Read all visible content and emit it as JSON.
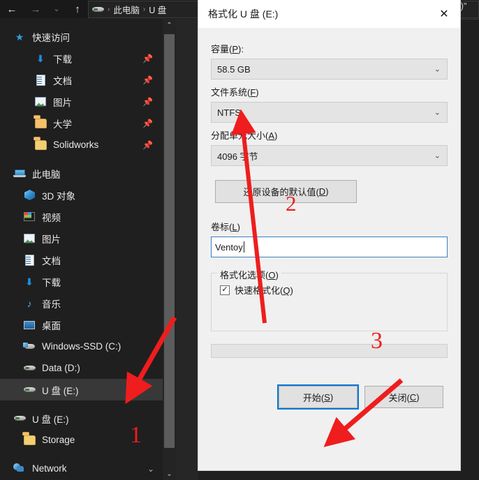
{
  "window": {
    "toolbar": {
      "back_icon": "arrow-left-icon",
      "forward_icon": "arrow-right-icon",
      "history_icon": "chevron-down-icon",
      "up_icon": "arrow-up-icon"
    },
    "breadcrumb": {
      "drive_icon": "drive-icon",
      "sep": "›",
      "items": [
        "此电脑",
        "U 盘"
      ],
      "occluded_tail": "E:)\""
    }
  },
  "sidebar": {
    "groups": [
      {
        "header": {
          "label": "快速访问",
          "icon": "star-icon"
        },
        "items": [
          {
            "label": "下载",
            "icon": "download-icon",
            "pinned": true
          },
          {
            "label": "文档",
            "icon": "document-icon",
            "pinned": true
          },
          {
            "label": "图片",
            "icon": "picture-icon",
            "pinned": true
          },
          {
            "label": "大学",
            "icon": "folder-icon",
            "pinned": true
          },
          {
            "label": "Solidworks",
            "icon": "folder-icon",
            "pinned": true
          }
        ]
      },
      {
        "header": {
          "label": "此电脑",
          "icon": "this-pc-icon"
        },
        "items": [
          {
            "label": "3D 对象",
            "icon": "3d-objects-icon",
            "pinned": false
          },
          {
            "label": "视频",
            "icon": "video-icon",
            "pinned": false
          },
          {
            "label": "图片",
            "icon": "picture-icon",
            "pinned": false
          },
          {
            "label": "文档",
            "icon": "document-icon",
            "pinned": false
          },
          {
            "label": "下载",
            "icon": "download-icon",
            "pinned": false
          },
          {
            "label": "音乐",
            "icon": "music-icon",
            "pinned": false
          },
          {
            "label": "桌面",
            "icon": "desktop-icon",
            "pinned": false
          },
          {
            "label": "Windows-SSD (C:)",
            "icon": "ssd-drive-icon",
            "pinned": false
          },
          {
            "label": "Data (D:)",
            "icon": "drive-icon",
            "pinned": false
          },
          {
            "label": "U 盘 (E:)",
            "icon": "drive-icon",
            "pinned": false,
            "selected": true
          }
        ]
      },
      {
        "header": {
          "label": "U 盘 (E:)",
          "icon": "drive-icon"
        },
        "items": [
          {
            "label": "Storage",
            "icon": "folder-icon",
            "pinned": false
          }
        ]
      },
      {
        "header": {
          "label": "Network",
          "icon": "network-icon",
          "expandable": true
        },
        "items": []
      }
    ],
    "scrollbar": {
      "up_icon": "chevron-up-icon",
      "down_icon": "chevron-down-icon"
    }
  },
  "dialog": {
    "title": "格式化 U 盘 (E:)",
    "close_icon": "close-icon",
    "capacity": {
      "label_pre": "容量(",
      "label_key": "P",
      "label_post": "):",
      "value": "58.5 GB",
      "chevron": "chevron-down-icon"
    },
    "filesystem": {
      "label_pre": "文件系统(",
      "label_key": "F",
      "label_post": ")",
      "value": "NTFS",
      "chevron": "chevron-down-icon"
    },
    "allocation": {
      "label_pre": "分配单元大小(",
      "label_key": "A",
      "label_post": ")",
      "value": "4096 字节",
      "chevron": "chevron-down-icon"
    },
    "restore_defaults": {
      "label_pre": "还原设备的默认值(",
      "label_key": "D",
      "label_post": ")"
    },
    "volume_label": {
      "label_pre": "卷标(",
      "label_key": "L",
      "label_post": ")",
      "value": "Ventoy"
    },
    "format_options": {
      "title_pre": "格式化选项(",
      "title_key": "O",
      "title_post": ")",
      "quick_format": {
        "label_pre": "快速格式化(",
        "label_key": "Q",
        "label_post": ")",
        "checked": true,
        "check_glyph": "✓"
      }
    },
    "progress": {
      "value": 0
    },
    "buttons": {
      "start": {
        "label_pre": "开始(",
        "label_key": "S",
        "label_post": ")",
        "focused": true
      },
      "close": {
        "label_pre": "关闭(",
        "label_key": "C",
        "label_post": ")",
        "focused": false
      }
    }
  },
  "annotations": {
    "color": "#ef1d1d",
    "markers": [
      {
        "number": "1",
        "points_to": "sidebar-item-u-disk-e"
      },
      {
        "number": "2",
        "points_to": "filesystem-combo"
      },
      {
        "number": "3",
        "points_to": "start-button"
      }
    ]
  }
}
